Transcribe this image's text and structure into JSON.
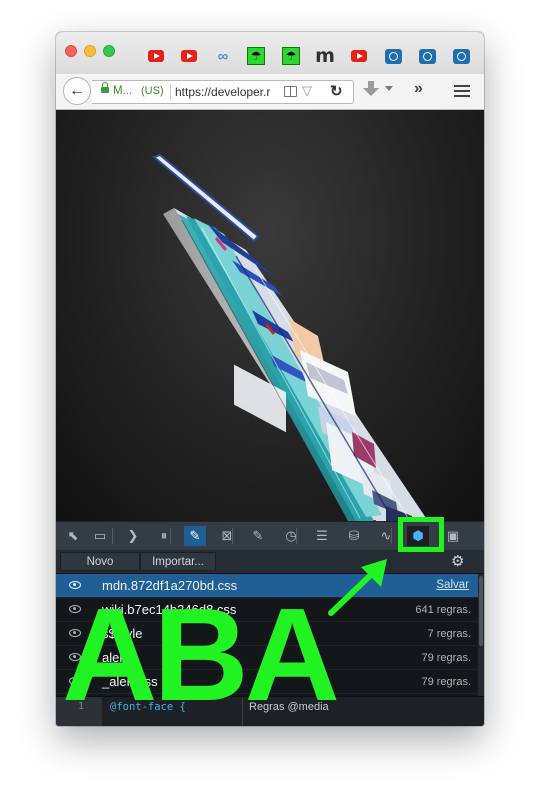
{
  "browser": {
    "pinned_tabs": [
      {
        "icon": "youtube-icon"
      },
      {
        "icon": "youtube-icon"
      },
      {
        "icon": "link-chain-icon"
      },
      {
        "icon": "green-umbrella-icon"
      },
      {
        "icon": "green-umbrella-icon"
      },
      {
        "icon": "m-letter-logo-icon"
      },
      {
        "icon": "youtube-icon"
      },
      {
        "icon": "devtools-blue-icon"
      },
      {
        "icon": "devtools-blue-icon"
      },
      {
        "icon": "devtools-blue-icon"
      }
    ],
    "mtext": "m",
    "site_identity": "M...",
    "site_country": "(US)",
    "url": "https://developer.r",
    "reload_glyph": "↻",
    "overflow_glyph": "»",
    "back_glyph": "🡐",
    "back_fallback": "←"
  },
  "devtools": {
    "tools": [
      {
        "icon": "element-picker-icon",
        "glyph": "⬉"
      },
      {
        "icon": "responsive-mode-icon",
        "glyph": "▭"
      },
      {
        "icon": "console-icon",
        "glyph": "❯"
      },
      {
        "icon": "debugger-icon",
        "glyph": "⏸"
      },
      {
        "icon": "style-editor-icon",
        "glyph": "✎",
        "selected": true
      },
      {
        "icon": "shader-editor-icon",
        "glyph": "⊠"
      },
      {
        "icon": "scratchpad-icon",
        "glyph": "✎"
      },
      {
        "icon": "performance-icon",
        "glyph": "◷"
      },
      {
        "icon": "network-icon",
        "glyph": "☰"
      },
      {
        "icon": "storage-icon",
        "glyph": "⛁"
      },
      {
        "icon": "web-audio-icon",
        "glyph": "∿"
      },
      {
        "icon": "3d-view-icon",
        "glyph": "⬢",
        "active": true
      },
      {
        "icon": "split-console-icon",
        "glyph": "▣"
      }
    ],
    "style_editor": {
      "new_label": "Novo",
      "import_label": "Importar...",
      "gear_glyph": "⚙",
      "sheets": [
        {
          "name": "mdn.872df1a270bd.css",
          "info": "Salvar",
          "selected": true
        },
        {
          "name": "wiki.b7ec14b346d8.css",
          "info": "641 regras."
        },
        {
          "name": "s$style",
          "info": "7 regras."
        },
        {
          "name": "alerts.",
          "info": "79 regras."
        },
        {
          "name": "_alerts.ss",
          "info": "79 regras."
        }
      ],
      "code_line_number": "1",
      "code_line": "@font-face {",
      "media_label": "Regras @media"
    }
  },
  "annotation": {
    "text": "ABA",
    "color": "#22f322"
  }
}
